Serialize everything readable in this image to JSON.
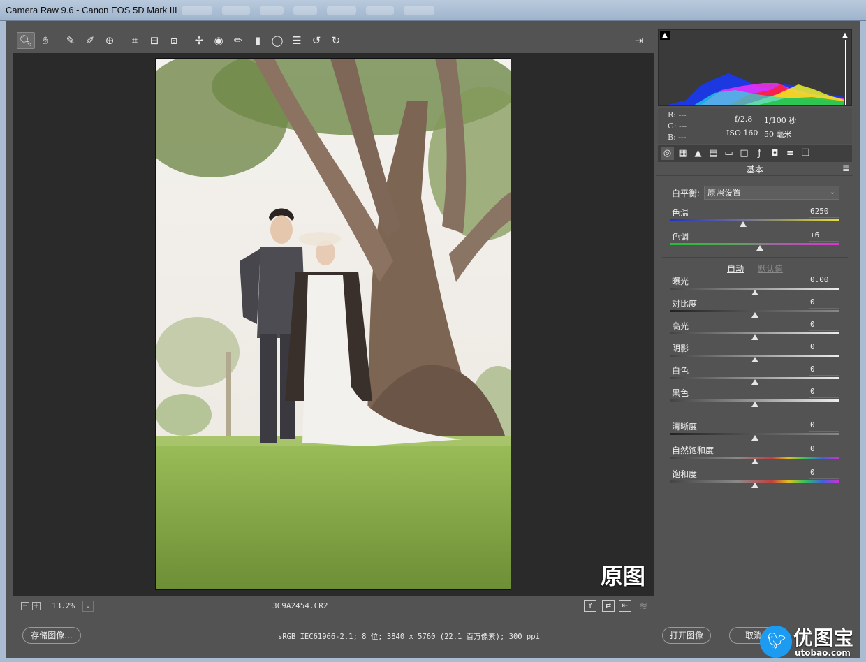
{
  "window": {
    "title": "Camera Raw 9.6 -  Canon EOS 5D Mark III"
  },
  "toolbar": {
    "tools": [
      "zoom-icon",
      "hand-icon",
      "white-balance-icon",
      "color-sampler-icon",
      "target-adjust-icon",
      "crop-icon",
      "straighten-icon",
      "transform-icon",
      "spot-removal-icon",
      "red-eye-icon",
      "adjustment-brush-icon",
      "graduated-filter-icon",
      "radial-filter-icon",
      "preferences-icon",
      "rotate-left-icon",
      "rotate-right-icon"
    ],
    "fullscreen_icon": "fullscreen-icon"
  },
  "preview": {
    "badge": "原图",
    "zoom": "13.2%",
    "filename": "3C9A2454.CR2",
    "view_buttons": [
      "Y",
      "⇄",
      "⇤"
    ]
  },
  "info": {
    "r": "R:  ---",
    "g": "G:  ---",
    "b": "B:  ---",
    "aperture": "f/2.8",
    "shutter": "1/100 秒",
    "iso": "ISO 160",
    "focal": "50 毫米"
  },
  "panel": {
    "title": "基本",
    "wb_label": "白平衡:",
    "wb_value": "原照设置",
    "auto_label": "自动",
    "default_label": "默认值",
    "sliders": [
      {
        "label": "色温",
        "value": "6250",
        "pos": 0.43,
        "type": "temp"
      },
      {
        "label": "色调",
        "value": "+6",
        "pos": 0.53,
        "type": "tint"
      },
      {
        "label": "曝光",
        "value": "0.00",
        "pos": 0.5,
        "type": "light"
      },
      {
        "label": "对比度",
        "value": "0",
        "pos": 0.5,
        "type": "dark"
      },
      {
        "label": "高光",
        "value": "0",
        "pos": 0.5,
        "type": "light"
      },
      {
        "label": "阴影",
        "value": "0",
        "pos": 0.5,
        "type": "light"
      },
      {
        "label": "白色",
        "value": "0",
        "pos": 0.5,
        "type": "light"
      },
      {
        "label": "黑色",
        "value": "0",
        "pos": 0.5,
        "type": "light"
      },
      {
        "label": "清晰度",
        "value": "0",
        "pos": 0.5,
        "type": "dark"
      },
      {
        "label": "自然饱和度",
        "value": "0",
        "pos": 0.5,
        "type": "vib"
      },
      {
        "label": "饱和度",
        "value": "0",
        "pos": 0.5,
        "type": "vib"
      }
    ]
  },
  "bottom": {
    "save_label": "存储图像...",
    "workflow": "sRGB IEC61966-2.1; 8 位; 3840 x 5760 (22.1 百万像素); 300 ppi",
    "open_label": "打开图像",
    "cancel_label": "取消"
  },
  "watermark": {
    "name": "优图宝",
    "url": "utobao.com"
  }
}
